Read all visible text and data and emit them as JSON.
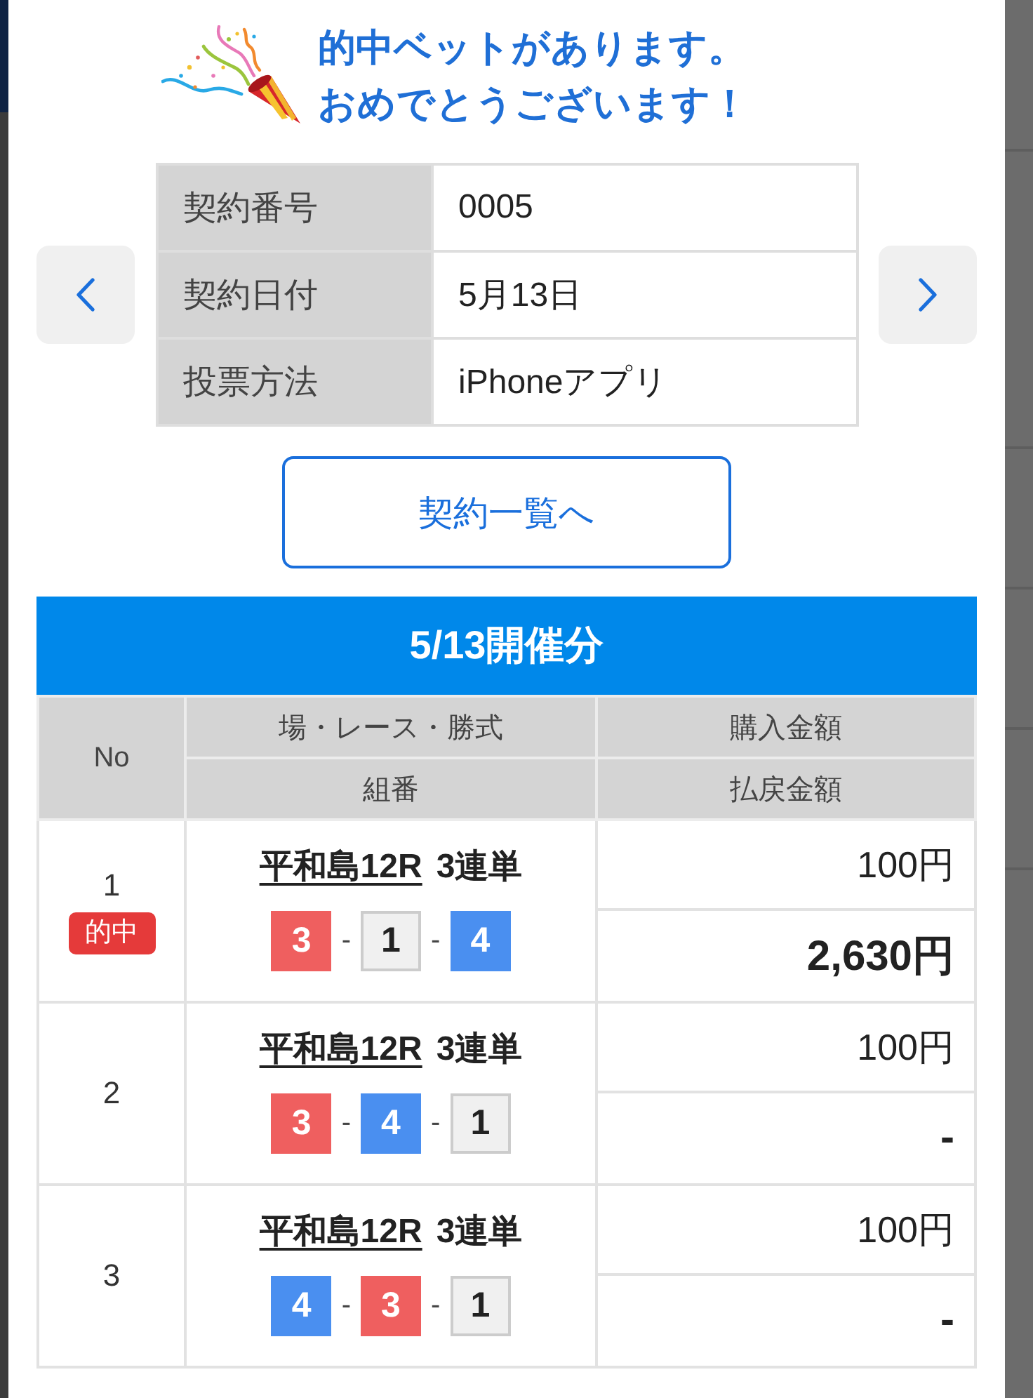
{
  "banner": {
    "lines": [
      "的中ベットがあります。",
      "おめでとうございます！"
    ]
  },
  "contract": {
    "rows": [
      {
        "label": "契約番号",
        "value": "0005"
      },
      {
        "label": "契約日付",
        "value": "5月13日"
      },
      {
        "label": "投票方法",
        "value": "iPhoneアプリ"
      }
    ]
  },
  "list_button": "契約一覧へ",
  "section": {
    "title": "5/13開催分",
    "header": {
      "no": "No",
      "race": "場・レース・勝式",
      "combination": "組番",
      "purchase": "購入金額",
      "payout": "払戻金額"
    },
    "rows": [
      {
        "no": "1",
        "badge": "的中",
        "race": "平和島12R",
        "bet_type": "3連単",
        "combination": [
          {
            "number": "3",
            "color": "#ef5f5f"
          },
          {
            "separator": "-",
            "number": "1",
            "color": "#f0f0f0"
          },
          {
            "separator": "-",
            "number": "4",
            "color": "#4a8ff0"
          }
        ],
        "purchase": "100円",
        "payout": "2,630円"
      },
      {
        "no": "2",
        "race": "平和島12R",
        "bet_type": "3連単",
        "combination": [
          {
            "number": "3",
            "color": "#ef5f5f"
          },
          {
            "separator": "-",
            "number": "4",
            "color": "#4a8ff0"
          },
          {
            "separator": "-",
            "number": "1",
            "color": "#f0f0f0"
          }
        ],
        "purchase": "100円",
        "payout": "-"
      },
      {
        "no": "3",
        "race": "平和島12R",
        "bet_type": "3連単",
        "combination": [
          {
            "number": "4",
            "color": "#4a8ff0"
          },
          {
            "separator": "-",
            "number": "3",
            "color": "#ef5f5f"
          },
          {
            "separator": "-",
            "number": "1",
            "color": "#f0f0f0"
          }
        ],
        "purchase": "100円",
        "payout": "-"
      }
    ]
  }
}
